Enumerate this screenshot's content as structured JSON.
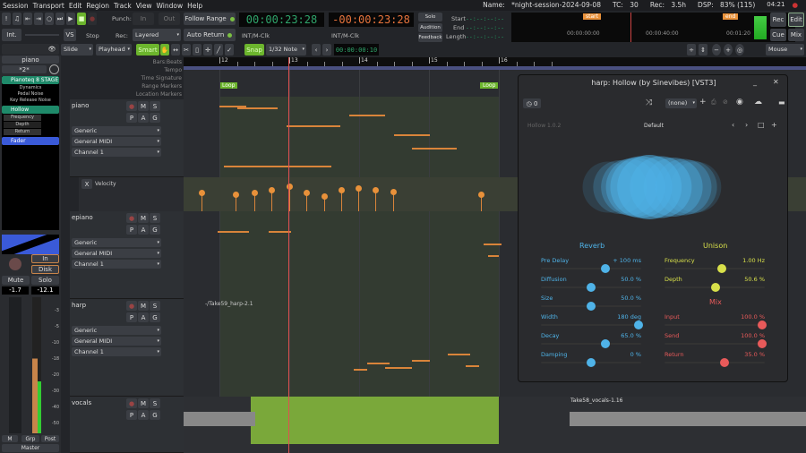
{
  "menu": [
    "Session",
    "Transport",
    "Edit",
    "Region",
    "Track",
    "View",
    "Window",
    "Help"
  ],
  "status": {
    "name_label": "Name:",
    "name": "*night-session-2024-09-08",
    "tc_label": "TC:",
    "tc": "30",
    "rec_label": "Rec:",
    "rec": "3.5h",
    "dsp_label": "DSP:",
    "dsp": "83% (115)",
    "time": "04:21"
  },
  "transport": {
    "punch": "Punch:",
    "in": "In",
    "out": "Out",
    "follow_range": "Follow Range",
    "auto_return": "Auto Return",
    "int": "Int.",
    "vs": "VS",
    "stop": "Stop",
    "rec": "Rec:",
    "rec_mode": "Layered",
    "clock1": "00:00:23:28",
    "clock1_sub": "INT/M-Clk",
    "clock2": "-00:00:23:28",
    "clock2_sub": "INT/M-Clk",
    "solo": "Solo",
    "audition": "Audition",
    "feedback": "Feedback",
    "start": "Start",
    "end": "End",
    "length": "Length",
    "empty_tc": "--:--:--:--",
    "mini_start": "start",
    "mini_end": "end",
    "mini_t0": "00:00:00:00",
    "mini_t1": "00:00:40:00",
    "mini_t2": "00:01:20",
    "rec_btn": "Rec",
    "edit_btn": "Edit",
    "cue_btn": "Cue",
    "mix_btn": "Mix"
  },
  "toolbar": {
    "edit_mode": "Slide",
    "ref": "Playhead",
    "smart": "Smart",
    "snap": "Snap",
    "grid": "1/32 Note",
    "nudge": "00:00:00:10",
    "zoom_focus": "Mouse"
  },
  "ruler": {
    "labels": [
      "Bars:Beats",
      "Tempo",
      "Time Signature",
      "Range Markers",
      "Location Markers"
    ],
    "bars": [
      "12",
      "13",
      "14",
      "15",
      "16"
    ],
    "loop": "Loop"
  },
  "strip": {
    "name": "piano",
    "preset": "*2*",
    "plugins": [
      {
        "name": "Pianoteq 8 STAGE",
        "color": "#1f8a6a",
        "params": [
          "Dynamics",
          "Pedal Noise",
          "Key Release Noise"
        ]
      },
      {
        "name": "Hollow",
        "color": "#1f8a6a",
        "params": [
          "Frequency",
          "Depth",
          "Return"
        ]
      },
      {
        "name": "Fader",
        "color": "#3a5ad8",
        "params": []
      }
    ],
    "in": "In",
    "disk": "Disk",
    "mute": "Mute",
    "solo": "Solo",
    "gain": "-1.7",
    "peak": "-12.1",
    "scale": [
      "-3",
      "-5",
      "-10",
      "-18",
      "-20",
      "-30",
      "-40",
      "-50"
    ],
    "m": "M",
    "grp": "Grp",
    "post": "Post",
    "master": "Master"
  },
  "tracks": [
    {
      "name": "piano",
      "combos": [
        "Generic",
        "General MIDI",
        "Channel 1"
      ]
    },
    {
      "name": "epiano",
      "combos": [
        "Generic",
        "General MIDI",
        "Channel 1"
      ]
    },
    {
      "name": "harp",
      "combos": [
        "Generic",
        "General MIDI",
        "Channel 1"
      ],
      "region": "-/Take59_harp-2.1"
    },
    {
      "name": "vocals",
      "region": "Take58_vocals-1.16"
    }
  ],
  "automation": {
    "name": "Velocity",
    "close": "X",
    "velocities": [
      0.6,
      0.55,
      0.6,
      0.7,
      0.8,
      0.6,
      0.5,
      0.7,
      0.75,
      0.7,
      0.65,
      0.55
    ]
  },
  "plugin": {
    "title": "harp: Hollow (by Sinevibes) [VST3]",
    "latency": "0",
    "preset": "(none)",
    "version": "Hollow 1.0.2",
    "preset_name": "Default",
    "reverb": "Reverb",
    "unison": "Unison",
    "mix": "Mix",
    "reverb_params": [
      {
        "label": "Pre Delay",
        "value": "+ 100 ms",
        "pos": 0.65
      },
      {
        "label": "Diffusion",
        "value": "50.0 %",
        "pos": 0.5
      },
      {
        "label": "Size",
        "value": "50.0 %",
        "pos": 0.5
      },
      {
        "label": "Width",
        "value": "180 deg",
        "pos": 1.0
      },
      {
        "label": "Decay",
        "value": "65.0 %",
        "pos": 0.65
      },
      {
        "label": "Damping",
        "value": "0 %",
        "pos": 0.5
      }
    ],
    "unison_params": [
      {
        "label": "Frequency",
        "value": "1.00 Hz",
        "pos": 0.58
      },
      {
        "label": "Depth",
        "value": "50.6 %",
        "pos": 0.51
      }
    ],
    "mix_params": [
      {
        "label": "Input",
        "value": "100.0 %",
        "pos": 1.0
      },
      {
        "label": "Send",
        "value": "100.0 %",
        "pos": 1.0
      },
      {
        "label": "Return",
        "value": "35.0 %",
        "pos": 0.6
      }
    ],
    "colors": {
      "reverb": "#4fb3e8",
      "unison": "#d8e04a",
      "mix": "#e85a5a"
    }
  }
}
